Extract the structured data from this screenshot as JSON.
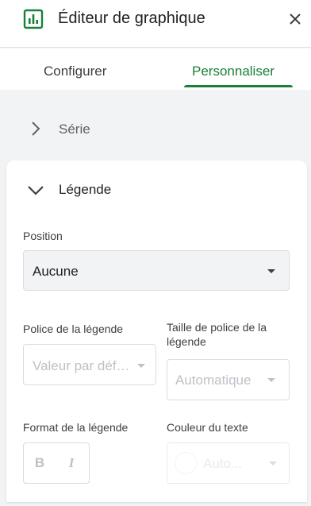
{
  "header": {
    "title": "Éditeur de graphique",
    "icon": "bar-chart-icon",
    "accent_color": "#188038"
  },
  "tabs": [
    {
      "label": "Configurer",
      "selected": false
    },
    {
      "label": "Personnaliser",
      "selected": true
    }
  ],
  "sections": {
    "serie": {
      "label": "Série",
      "expanded": false
    },
    "legende": {
      "label": "Légende",
      "expanded": true,
      "position": {
        "label": "Position",
        "value": "Aucune"
      },
      "police": {
        "label": "Police de la légende",
        "value": "Valeur par déf…",
        "disabled": true
      },
      "taille": {
        "label": "Taille de police de la légende",
        "value": "Automatique",
        "disabled": true
      },
      "format": {
        "label": "Format de la légende",
        "bold_glyph": "B",
        "italic_glyph": "I",
        "disabled": true
      },
      "couleur": {
        "label": "Couleur du texte",
        "value": "Auto...",
        "disabled": true
      }
    }
  }
}
